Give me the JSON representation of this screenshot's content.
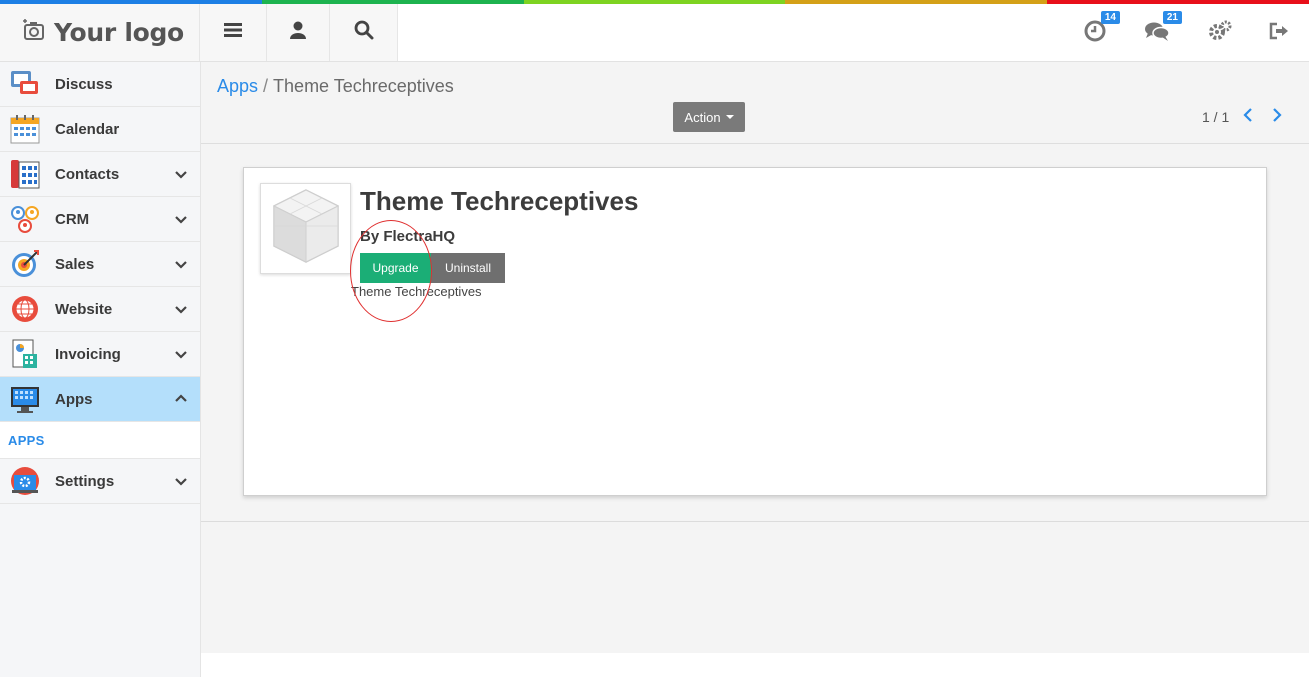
{
  "colors": {
    "strip": [
      "#1d7fe5",
      "#1db34f",
      "#7ed321",
      "#d4a017",
      "#e8101a"
    ],
    "accent": "#2a8be8",
    "upgrade": "#1bae76",
    "active_nav": "#b4dffb"
  },
  "header": {
    "logo_text": "Your logo",
    "activity_badge": "14",
    "messages_badge": "21",
    "icons": [
      "camera-icon",
      "menu-icon",
      "user-icon",
      "search-icon",
      "clock-icon",
      "chat-icon",
      "gears-icon",
      "logout-icon"
    ]
  },
  "sidebar": {
    "items": [
      {
        "label": "Discuss",
        "icon": "discuss-icon"
      },
      {
        "label": "Calendar",
        "icon": "calendar-icon"
      },
      {
        "label": "Contacts",
        "icon": "contacts-icon"
      },
      {
        "label": "CRM",
        "icon": "crm-icon"
      },
      {
        "label": "Sales",
        "icon": "sales-icon"
      },
      {
        "label": "Website",
        "icon": "website-icon"
      },
      {
        "label": "Invoicing",
        "icon": "invoicing-icon"
      },
      {
        "label": "Apps",
        "icon": "apps-icon"
      },
      {
        "label": "Settings",
        "icon": "settings-icon"
      }
    ],
    "sub_item": "APPS"
  },
  "control": {
    "breadcrumb_root": "Apps",
    "breadcrumb_sep": "/",
    "breadcrumb_current": "Theme Techreceptives",
    "action_label": "Action",
    "pager": "1 / 1"
  },
  "app": {
    "title": "Theme Techreceptives",
    "author": "By FlectraHQ",
    "upgrade_label": "Upgrade",
    "uninstall_label": "Uninstall",
    "summary": "Theme Techreceptives"
  }
}
